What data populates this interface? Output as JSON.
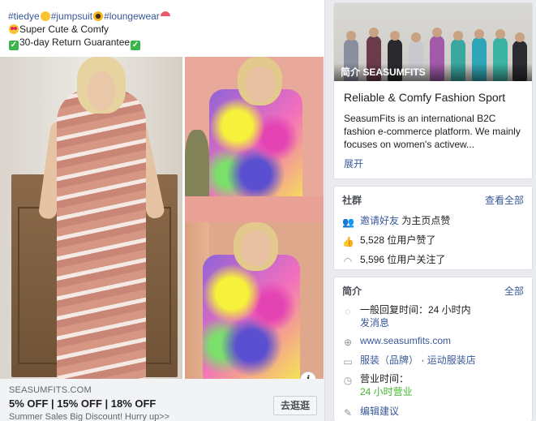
{
  "post": {
    "line1_tags": "#tiedye",
    "line1_tags2": "#jumpsuit",
    "line1_tags3": "#loungewear",
    "line2": "Super Cute & Comfy",
    "line3": "30-day Return Guarantee",
    "info_icon": "i"
  },
  "ad_footer": {
    "domain": "SEASUMFITS.COM",
    "headline": "5% OFF | 15% OFF | 18% OFF",
    "description": "Summer Sales Big Discount! Hurry up>>",
    "cta": "去逛逛"
  },
  "page_card": {
    "cover_label": "简介 SEASUMFITS",
    "title": "Reliable & Comfy Fashion Sport",
    "description": "SeasumFits is an international B2C fashion e-commerce platform. We mainly focuses on women's activew...",
    "expand": "展开"
  },
  "community": {
    "heading": "社群",
    "see_all": "查看全部",
    "invite_link": "邀请好友",
    "invite_suffix": " 为主页点赞",
    "likes": "5,528 位用户赞了",
    "follows": "5,596 位用户关注了"
  },
  "about": {
    "heading": "简介",
    "see_all": "全部",
    "response_time": "一般回复时间：24 小时内",
    "send_message": "发消息",
    "website": "www.seasumfits.com",
    "category1": "服装（品牌）",
    "category_sep": " · ",
    "category2": "运动服装店",
    "hours_label": "营业时间：",
    "hours_value": "24 小时营业",
    "suggest_edit": "编辑建议"
  }
}
